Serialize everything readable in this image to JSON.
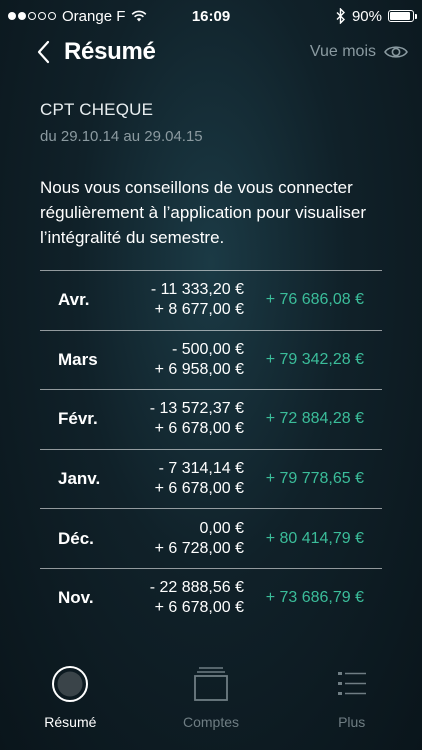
{
  "status": {
    "carrier": "Orange F",
    "time": "16:09",
    "battery": "90%",
    "battery_level": 0.9
  },
  "nav": {
    "title": "Résumé",
    "right_label": "Vue mois"
  },
  "account": {
    "name": "CPT CHEQUE",
    "period": "du 29.10.14 au 29.04.15"
  },
  "advice": "Nous vous conseillons de vous connecter régulièrement à l’application pour visualiser l’intégralité du semestre.",
  "rows": [
    {
      "month": "Avr.",
      "debit": "- 11 333,20  €",
      "credit": "+ 8 677,00  €",
      "total": "+ 76 686,08  €"
    },
    {
      "month": "Mars",
      "debit": "- 500,00  €",
      "credit": "+ 6 958,00  €",
      "total": "+ 79 342,28  €"
    },
    {
      "month": "Févr.",
      "debit": "- 13 572,37  €",
      "credit": "+ 6 678,00  €",
      "total": "+ 72 884,28  €"
    },
    {
      "month": "Janv.",
      "debit": "- 7 314,14  €",
      "credit": "+ 6 678,00  €",
      "total": "+ 79 778,65  €"
    },
    {
      "month": "Déc.",
      "debit": "0,00  €",
      "credit": "+ 6 728,00  €",
      "total": "+ 80 414,79  €"
    },
    {
      "month": "Nov.",
      "debit": "- 22 888,56  €",
      "credit": "+ 6 678,00  €",
      "total": "+ 73 686,79  €"
    }
  ],
  "tabs": [
    {
      "label": "Résumé",
      "icon": "summary-circle-icon",
      "active": true
    },
    {
      "label": "Comptes",
      "icon": "accounts-stack-icon",
      "active": false
    },
    {
      "label": "Plus",
      "icon": "list-menu-icon",
      "active": false
    }
  ],
  "colors": {
    "accent_positive": "#3bbd9a",
    "muted": "#8b9aa0",
    "background": "#102129"
  }
}
